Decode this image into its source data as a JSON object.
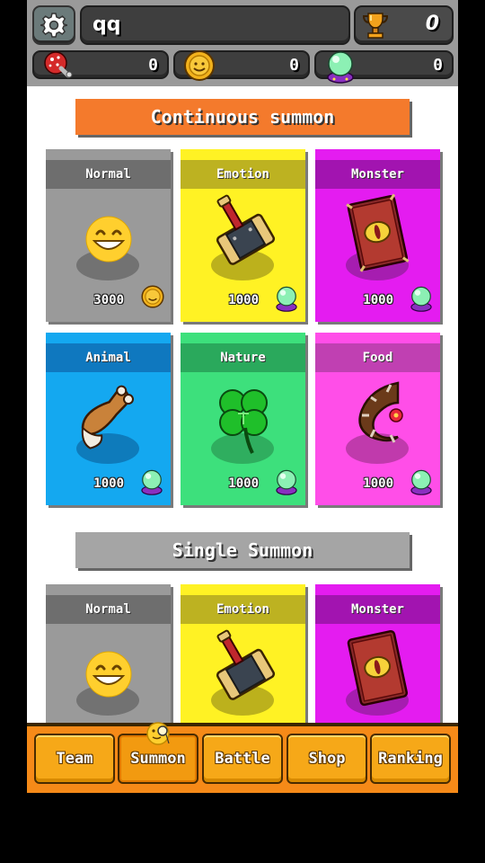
{
  "header": {
    "player_name": "qq",
    "trophy_value": "0",
    "resources": [
      {
        "name": "meat",
        "icon": "meat-icon",
        "value": "0"
      },
      {
        "name": "coin",
        "icon": "coin-icon",
        "value": "0"
      },
      {
        "name": "orb",
        "icon": "green-orb-icon",
        "value": "0"
      }
    ]
  },
  "sections": {
    "continuous_title": "Continuous summon",
    "single_title": "Single Summon"
  },
  "continuous_cards": [
    {
      "label": "Normal",
      "price": "3000",
      "price_icon": "coin-icon",
      "art": "smiley-icon",
      "color": "#9a9a9a"
    },
    {
      "label": "Emotion",
      "price": "1000",
      "price_icon": "green-orb-icon",
      "art": "hammer-icon",
      "color": "#fff224"
    },
    {
      "label": "Monster",
      "price": "1000",
      "price_icon": "green-orb-icon",
      "art": "spellbook-icon",
      "color": "#e41cf0"
    },
    {
      "label": "Animal",
      "price": "1000",
      "price_icon": "green-orb-icon",
      "art": "bone-icon",
      "color": "#14a8f0"
    },
    {
      "label": "Nature",
      "price": "1000",
      "price_icon": "green-orb-icon",
      "art": "clover-icon",
      "color": "#3de07c"
    },
    {
      "label": "Food",
      "price": "1000",
      "price_icon": "green-orb-icon",
      "art": "thorn-vine-icon",
      "color": "#ff4ee8"
    }
  ],
  "single_cards": [
    {
      "label": "Normal",
      "art": "smiley-icon",
      "color": "#9a9a9a"
    },
    {
      "label": "Emotion",
      "art": "hammer-icon",
      "color": "#fff224"
    },
    {
      "label": "Monster",
      "art": "spellbook-icon",
      "color": "#e41cf0"
    }
  ],
  "nav": {
    "active": "Summon",
    "items": [
      "Team",
      "Summon",
      "Battle",
      "Shop",
      "Ranking"
    ]
  }
}
